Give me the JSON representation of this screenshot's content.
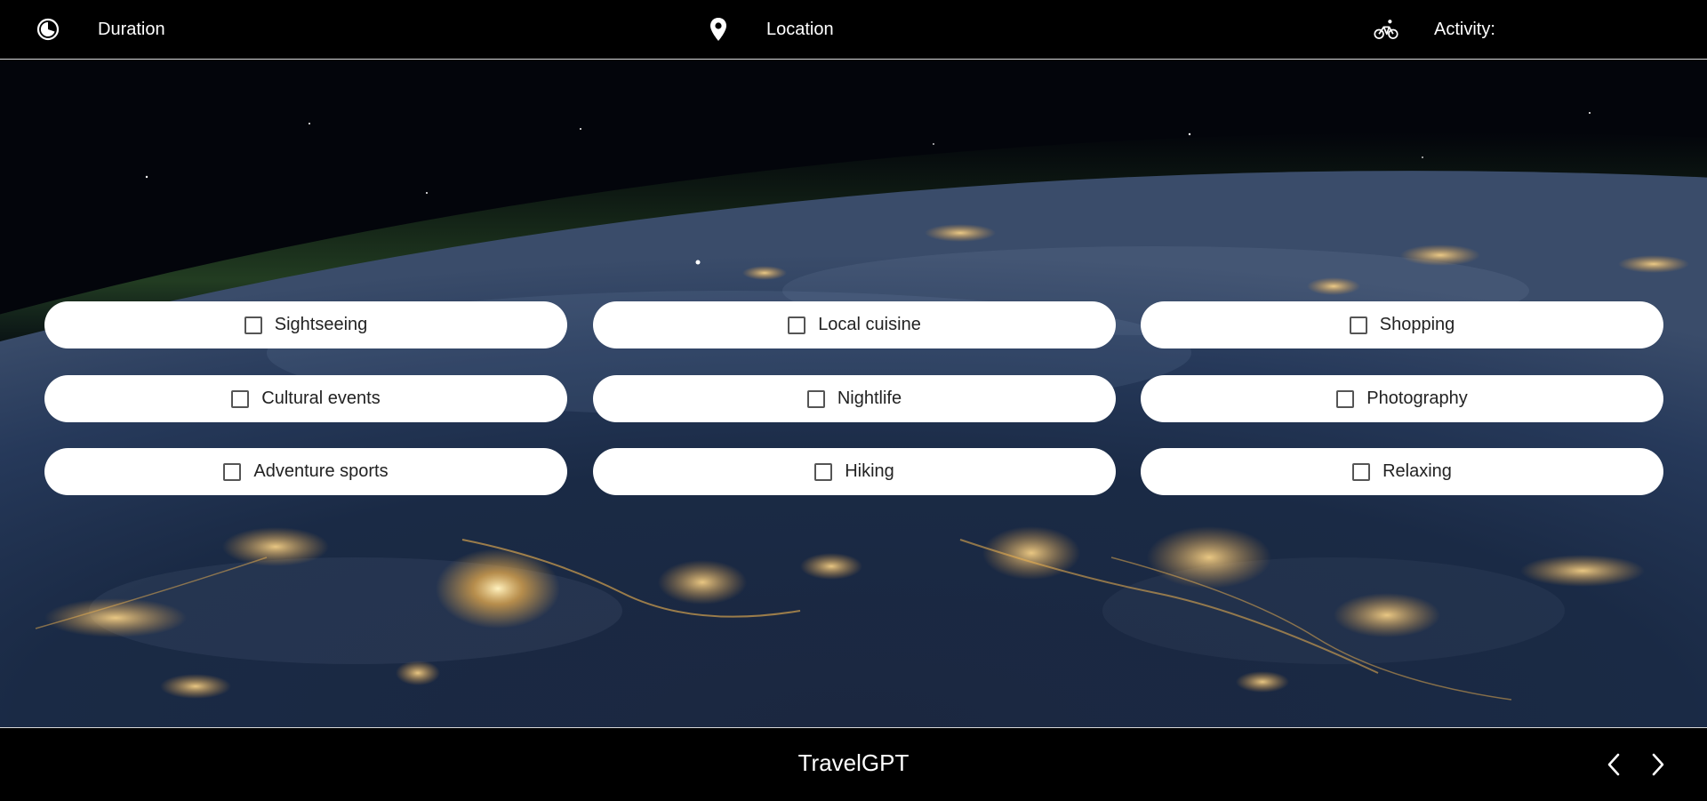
{
  "header": {
    "duration": {
      "label": "Duration",
      "icon": "timer-icon"
    },
    "location": {
      "label": "Location",
      "icon": "map-pin-icon"
    },
    "activity": {
      "label": "Activity:",
      "icon": "bicycle-icon"
    }
  },
  "activities": [
    {
      "label": "Sightseeing",
      "checked": false
    },
    {
      "label": "Local cuisine",
      "checked": false
    },
    {
      "label": "Shopping",
      "checked": false
    },
    {
      "label": "Cultural events",
      "checked": false
    },
    {
      "label": "Nightlife",
      "checked": false
    },
    {
      "label": "Photography",
      "checked": false
    },
    {
      "label": "Adventure sports",
      "checked": false
    },
    {
      "label": "Hiking",
      "checked": false
    },
    {
      "label": "Relaxing",
      "checked": false
    }
  ],
  "footer": {
    "brand": "TravelGPT",
    "prev_icon": "chevron-left-icon",
    "next_icon": "chevron-right-icon"
  },
  "colors": {
    "bar_background": "#000000",
    "divider": "#d9d9d9",
    "option_background": "#ffffff",
    "option_text": "#222222"
  }
}
